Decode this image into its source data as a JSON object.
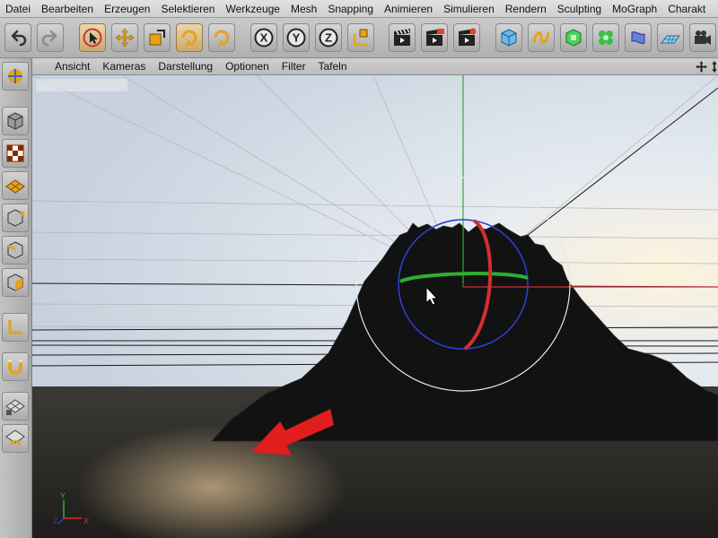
{
  "menubar": {
    "items": [
      "Datei",
      "Bearbeiten",
      "Erzeugen",
      "Selektieren",
      "Werkzeuge",
      "Mesh",
      "Snapping",
      "Animieren",
      "Simulieren",
      "Rendern",
      "Sculpting",
      "MoGraph",
      "Charakt"
    ]
  },
  "toolbar": {
    "axis_x": "X",
    "axis_y": "Y",
    "axis_z": "Z"
  },
  "viewport": {
    "menu": [
      "Ansicht",
      "Kameras",
      "Darstellung",
      "Optionen",
      "Filter",
      "Tafeln"
    ],
    "label": "",
    "axis_labels": {
      "y": "Y",
      "z": "Z",
      "x": "X"
    }
  },
  "colors": {
    "axis_x": "#d03030",
    "axis_y": "#2fae2f",
    "axis_z": "#2b3fd0",
    "arrow_annotation": "#e21d1d",
    "active_tool": "#c9a86c"
  },
  "icons": {
    "undo": "undo-icon",
    "redo": "redo-icon",
    "select": "select-arrow-icon",
    "move": "move-icon",
    "scale": "scale-icon",
    "rotate": "rotate-icon",
    "render": "clapperboard-icon",
    "cube": "cube-icon",
    "camera": "camera-icon"
  }
}
